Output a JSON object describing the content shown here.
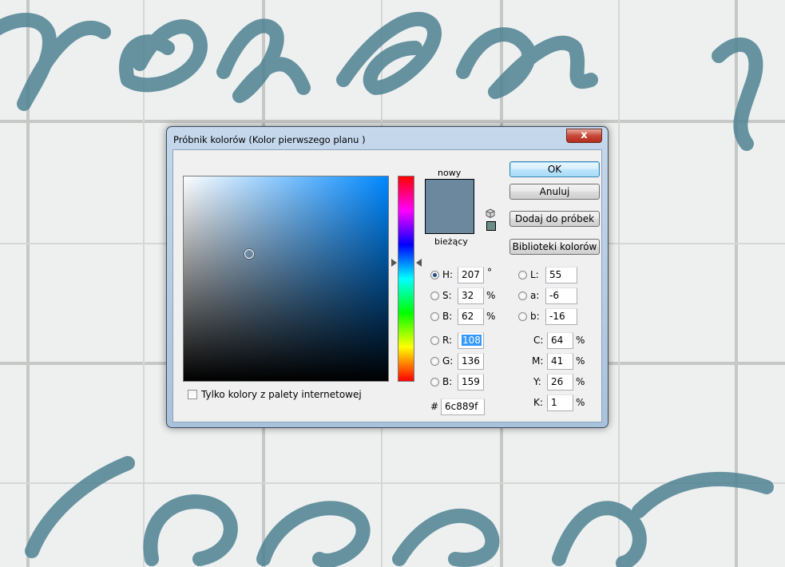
{
  "dialog": {
    "title": "Próbnik kolorów (Kolor pierwszego planu )",
    "close_label": "x"
  },
  "colors": {
    "new": "#6c889f",
    "current": "#6c889f",
    "gamut_warning": "#6c8c88",
    "hue_base": "#0088ff"
  },
  "swatch": {
    "new_label": "nowy",
    "current_label": "bieżący"
  },
  "buttons": {
    "ok": "OK",
    "cancel": "Anuluj",
    "add_to_swatches": "Dodaj do próbek",
    "color_libraries": "Biblioteki kolorów"
  },
  "hsb": {
    "h_label": "H:",
    "h_value": "207",
    "h_unit": "°",
    "s_label": "S:",
    "s_value": "32",
    "s_unit": "%",
    "b_label": "B:",
    "b_value": "62",
    "b_unit": "%"
  },
  "rgb": {
    "r_label": "R:",
    "r_value": "108",
    "g_label": "G:",
    "g_value": "136",
    "b_label": "B:",
    "b_value": "159"
  },
  "lab": {
    "l_label": "L:",
    "l_value": "55",
    "a_label": "a:",
    "a_value": "-6",
    "b_label": "b:",
    "b_value": "-16"
  },
  "cmyk": {
    "c_label": "C:",
    "c_value": "64",
    "c_unit": "%",
    "m_label": "M:",
    "m_value": "41",
    "m_unit": "%",
    "y_label": "Y:",
    "y_value": "26",
    "y_unit": "%",
    "k_label": "K:",
    "k_value": "1",
    "k_unit": "%"
  },
  "hex": {
    "label": "#",
    "value": "6c889f"
  },
  "web_only": {
    "label": "Tylko kolory z palety internetowej",
    "checked": false
  },
  "icons": [
    "close-icon",
    "cube-icon",
    "hue-slider-left-arrow-icon",
    "hue-slider-right-arrow-icon"
  ]
}
